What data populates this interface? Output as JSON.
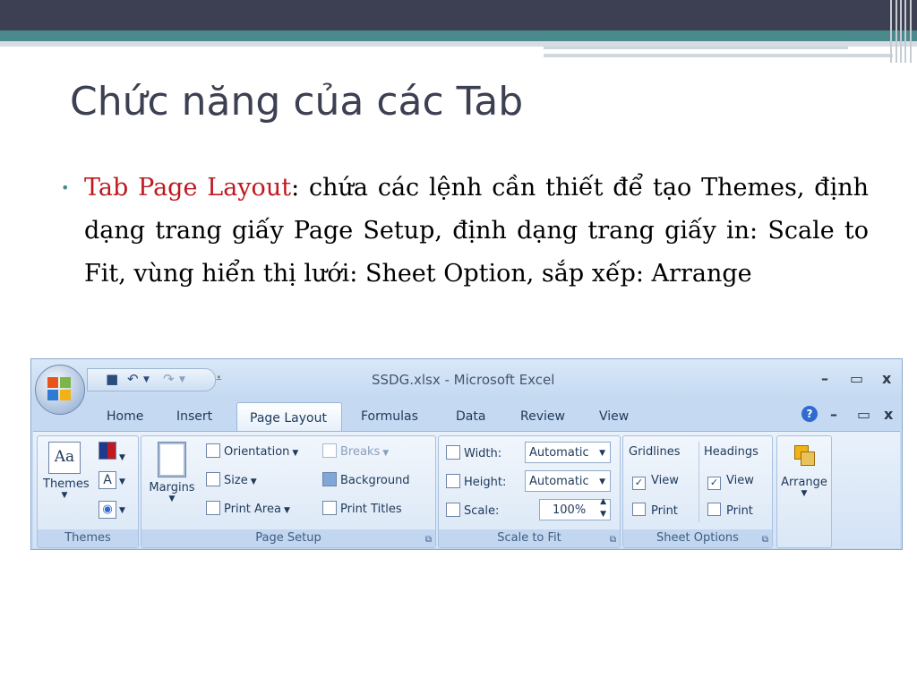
{
  "slide": {
    "title": "Chức năng của các Tab",
    "bullet_symbol": "•",
    "bullet_lead": "Tab Page Layout",
    "bullet_text": ": chứa các lệnh cần thiết để tạo Themes, định dạng trang giấy Page Setup, định dạng trang giấy in: Scale to Fit, vùng hiển thị lưới: Sheet Option, sắp xếp: Arrange"
  },
  "colors": {
    "accent_red": "#c0181e",
    "header_dark": "#3d4052",
    "header_teal": "#4a8a8c",
    "ribbon_blue": "#c5daf2"
  },
  "excel": {
    "window_title": "SSDG.xlsx - Microsoft Excel",
    "window_controls": [
      "–",
      "▭",
      "x"
    ],
    "workbook_controls": [
      "?",
      "–",
      "▭",
      "x"
    ],
    "quick_access_icons": [
      "save-icon",
      "undo-icon",
      "redo-icon",
      "customize-icon"
    ],
    "tabs": [
      "Home",
      "Insert",
      "Page Layout",
      "Formulas",
      "Data",
      "Review",
      "View"
    ],
    "active_tab": "Page Layout",
    "groups": {
      "themes": {
        "label": "Themes",
        "big_button": "Themes",
        "small_icons": [
          "colors-icon",
          "fonts-icon",
          "effects-icon"
        ],
        "font_glyph": "A",
        "theme_glyph": "Aa"
      },
      "page_setup": {
        "label": "Page Setup",
        "margins": "Margins",
        "orientation": "Orientation",
        "size": "Size",
        "print_area": "Print Area",
        "breaks": "Breaks",
        "background": "Background",
        "print_titles": "Print Titles"
      },
      "scale_to_fit": {
        "label": "Scale to Fit",
        "width_label": "Width:",
        "width_value": "Automatic",
        "height_label": "Height:",
        "height_value": "Automatic",
        "scale_label": "Scale:",
        "scale_value": "100%"
      },
      "sheet_options": {
        "label": "Sheet Options",
        "gridlines": "Gridlines",
        "headings": "Headings",
        "view": "View",
        "print": "Print",
        "gridlines_view_checked": true,
        "gridlines_print_checked": false,
        "headings_view_checked": true,
        "headings_print_checked": false
      },
      "arrange": {
        "big_button": "Arrange"
      }
    }
  }
}
